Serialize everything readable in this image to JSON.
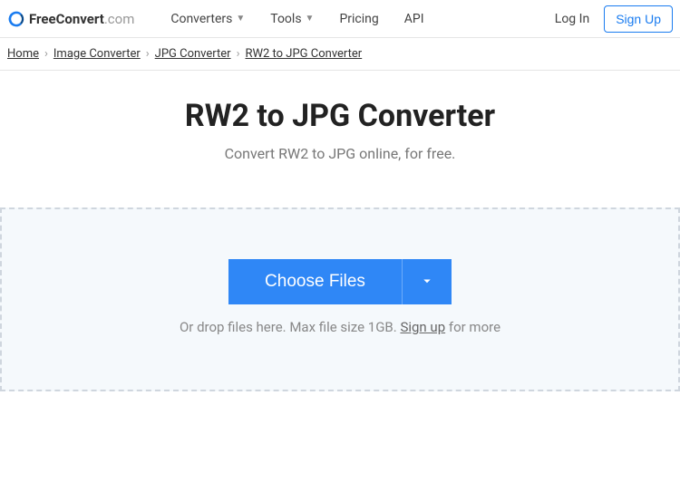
{
  "header": {
    "logo_bold": "FreeConvert",
    "logo_dim": ".com",
    "nav": {
      "converters": "Converters",
      "tools": "Tools",
      "pricing": "Pricing",
      "api": "API"
    },
    "auth": {
      "login": "Log In",
      "signup": "Sign Up"
    }
  },
  "breadcrumb": {
    "home": "Home",
    "image_converter": "Image Converter",
    "jpg_converter": "JPG Converter",
    "current": "RW2 to JPG Converter"
  },
  "hero": {
    "title": "RW2 to JPG Converter",
    "subtitle": "Convert RW2 to JPG online, for free."
  },
  "dropzone": {
    "choose_label": "Choose Files",
    "hint_prefix": "Or drop files here. Max file size 1GB. ",
    "signup_link": "Sign up",
    "hint_suffix": " for more"
  }
}
